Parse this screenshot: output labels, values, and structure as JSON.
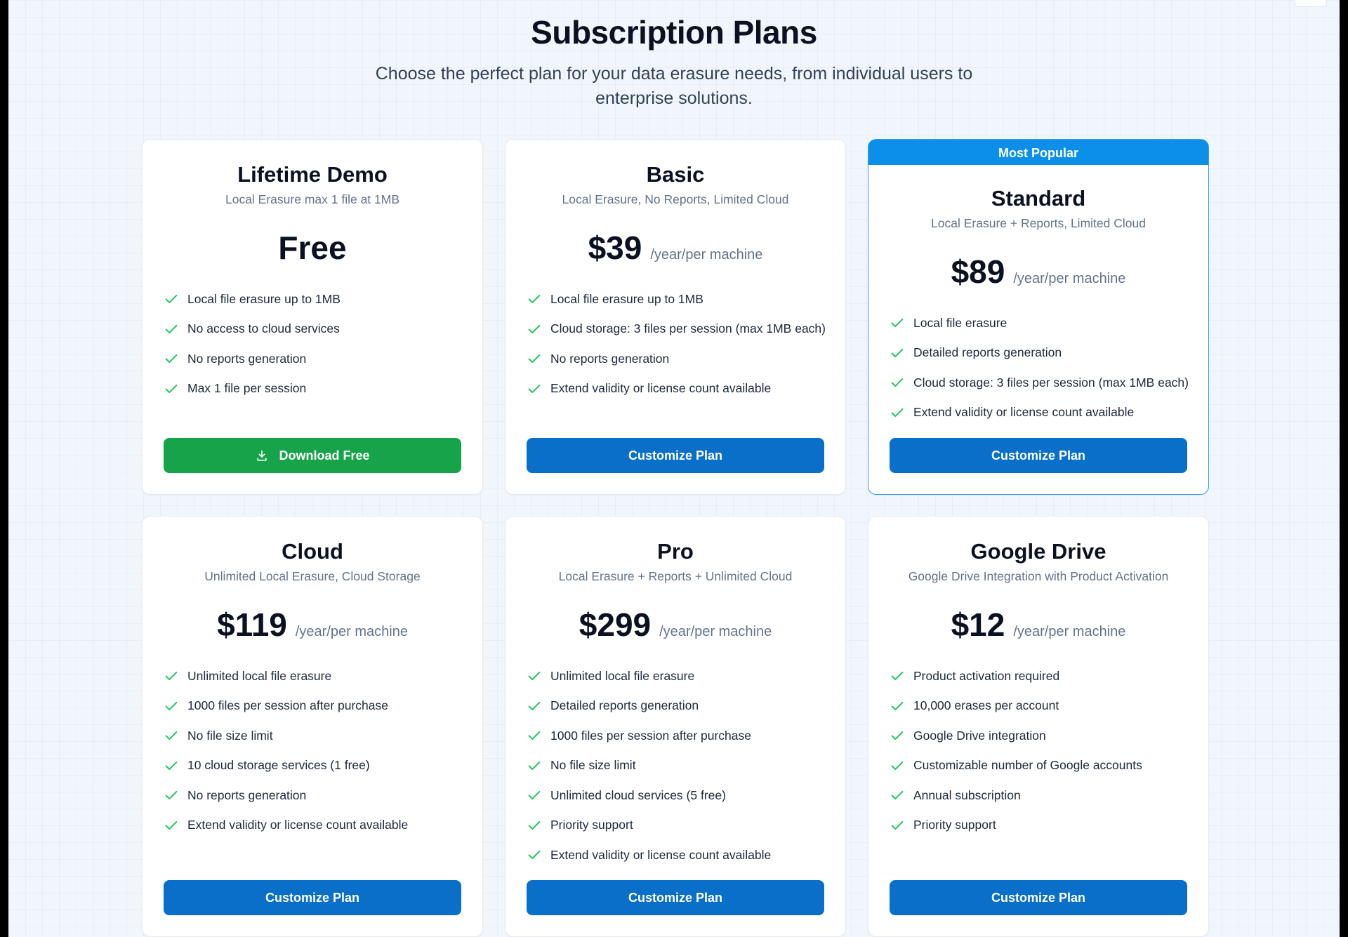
{
  "header": {
    "title": "Subscription Plans",
    "subtitle": "Choose the perfect plan for your data erasure needs, from individual users to enterprise solutions."
  },
  "colors": {
    "accent": "#0a6fc8",
    "success": "#16a34a",
    "badge": "#0b8fe8",
    "check": "#22c55e"
  },
  "plans": [
    {
      "name": "Lifetime Demo",
      "desc": "Local Erasure max 1 file at 1MB",
      "price": "Free",
      "per": "",
      "features": [
        "Local file erasure up to 1MB",
        "No access to cloud services",
        "No reports generation",
        "Max 1 file per session"
      ],
      "button": "Download Free",
      "button_icon": "download-icon"
    },
    {
      "name": "Basic",
      "desc": "Local Erasure, No Reports, Limited Cloud",
      "price": "$39",
      "per": "/year/per machine",
      "features": [
        "Local file erasure up to 1MB",
        "Cloud storage: 3 files per session (max 1MB each)",
        "No reports generation",
        "Extend validity or license count available"
      ],
      "button": "Customize Plan"
    },
    {
      "badge": "Most Popular",
      "name": "Standard",
      "desc": "Local Erasure + Reports, Limited Cloud",
      "price": "$89",
      "per": "/year/per machine",
      "features": [
        "Local file erasure",
        "Detailed reports generation",
        "Cloud storage: 3 files per session (max 1MB each)",
        "Extend validity or license count available"
      ],
      "button": "Customize Plan"
    },
    {
      "name": "Cloud",
      "desc": "Unlimited Local Erasure, Cloud Storage",
      "price": "$119",
      "per": "/year/per machine",
      "features": [
        "Unlimited local file erasure",
        "1000 files per session after purchase",
        "No file size limit",
        "10 cloud storage services (1 free)",
        "No reports generation",
        "Extend validity or license count available"
      ],
      "button": "Customize Plan"
    },
    {
      "name": "Pro",
      "desc": "Local Erasure + Reports + Unlimited Cloud",
      "price": "$299",
      "per": "/year/per machine",
      "features": [
        "Unlimited local file erasure",
        "Detailed reports generation",
        "1000 files per session after purchase",
        "No file size limit",
        "Unlimited cloud services (5 free)",
        "Priority support",
        "Extend validity or license count available"
      ],
      "button": "Customize Plan"
    },
    {
      "name": "Google Drive",
      "desc": "Google Drive Integration with Product Activation",
      "price": "$12",
      "per": "/year/per machine",
      "features": [
        "Product activation required",
        "10,000 erases per account",
        "Google Drive integration",
        "Customizable number of Google accounts",
        "Annual subscription",
        "Priority support"
      ],
      "button": "Customize Plan"
    }
  ]
}
